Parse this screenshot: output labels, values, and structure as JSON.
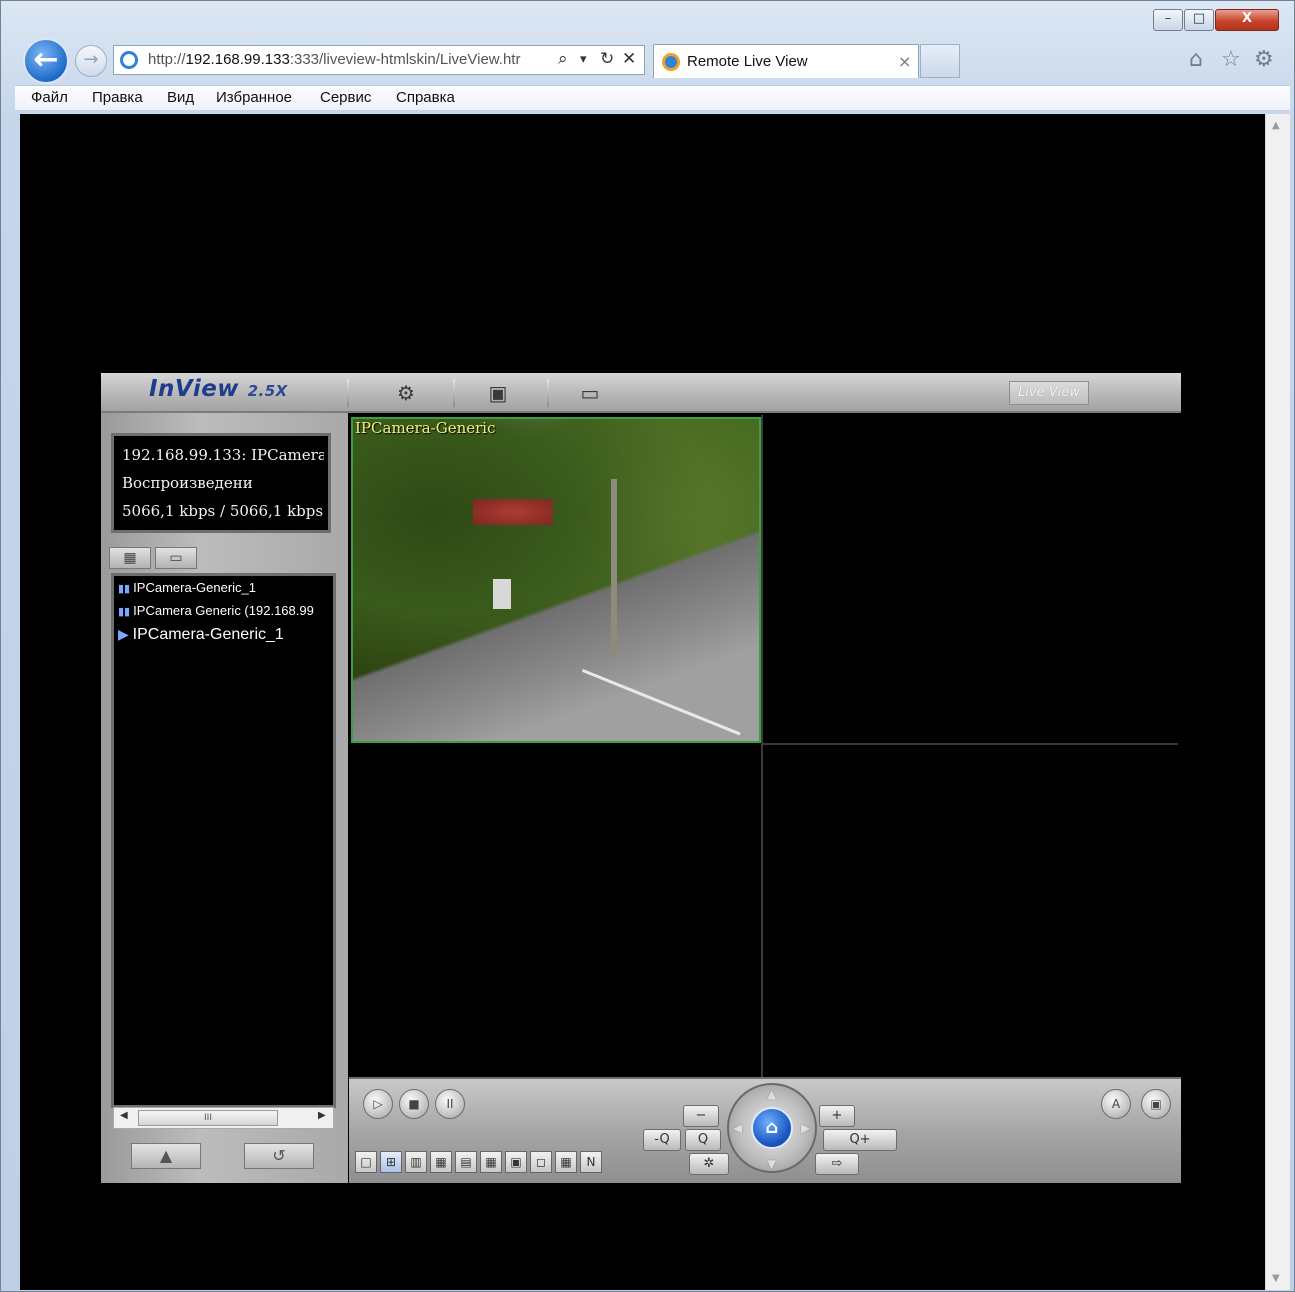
{
  "browser": {
    "url_prefix": "http://",
    "url_host": "192.168.99.133",
    "url_rest": ":333/liveview-htmlskin/LiveView.htr",
    "tab_title": "Remote Live View",
    "window_controls": {
      "minimize": "–",
      "maximize": "□",
      "close": "X"
    },
    "nav_icons": [
      "back-icon",
      "forward-icon"
    ],
    "address_icons": {
      "search": "⌕",
      "dropdown": "▾",
      "refresh": "↻",
      "stop": "✕"
    },
    "tab_close": "×",
    "toolbar_icons": {
      "home": "⌂",
      "favorites": "☆",
      "settings": "⚙"
    }
  },
  "menu": [
    "Файл",
    "Правка",
    "Вид",
    "Избранное",
    "Сервис",
    "Справка"
  ],
  "inview": {
    "logo": "InView",
    "version": "2.5X",
    "top_icons": [
      "camera-reel-icon",
      "recording-icon",
      "monitor-settings-icon"
    ],
    "live_view_label": "Live View",
    "info": {
      "line1": "192.168.99.133: IPCamera",
      "line2": "Воспроизведени",
      "line3": "5066,1 kbps / 5066,1 kbps"
    },
    "tree": [
      {
        "label": "IPCamera-Generic_1",
        "icon": "server-icon"
      },
      {
        "label": "IPCamera Generic (192.168.99",
        "icon": "server-icon"
      },
      {
        "label": "IPCamera-Generic_1",
        "icon": "camera-play-icon"
      }
    ],
    "scroll_thumb": "III",
    "video_cells": [
      {
        "label": "IPCamera-Generic",
        "active": true
      },
      {
        "label": "",
        "active": false
      },
      {
        "label": "",
        "active": false
      },
      {
        "label": "",
        "active": false
      }
    ],
    "playback": {
      "play": "▷",
      "stop": "■",
      "pause": "II"
    },
    "layouts": [
      "□",
      "⊞",
      "▥",
      "▦",
      "▤",
      "▦",
      "▣",
      "◻",
      "▦",
      "N"
    ],
    "ptz": {
      "minus": "−",
      "plus": "+",
      "zoom_out": "-Q",
      "zoom": "Q",
      "zoom_in": "Q+",
      "settings": "✲",
      "next": "⇨",
      "home": "⌂"
    },
    "right_icons": [
      "auto-icon",
      "fullscreen-icon"
    ],
    "accent_green": "#39a23a"
  }
}
